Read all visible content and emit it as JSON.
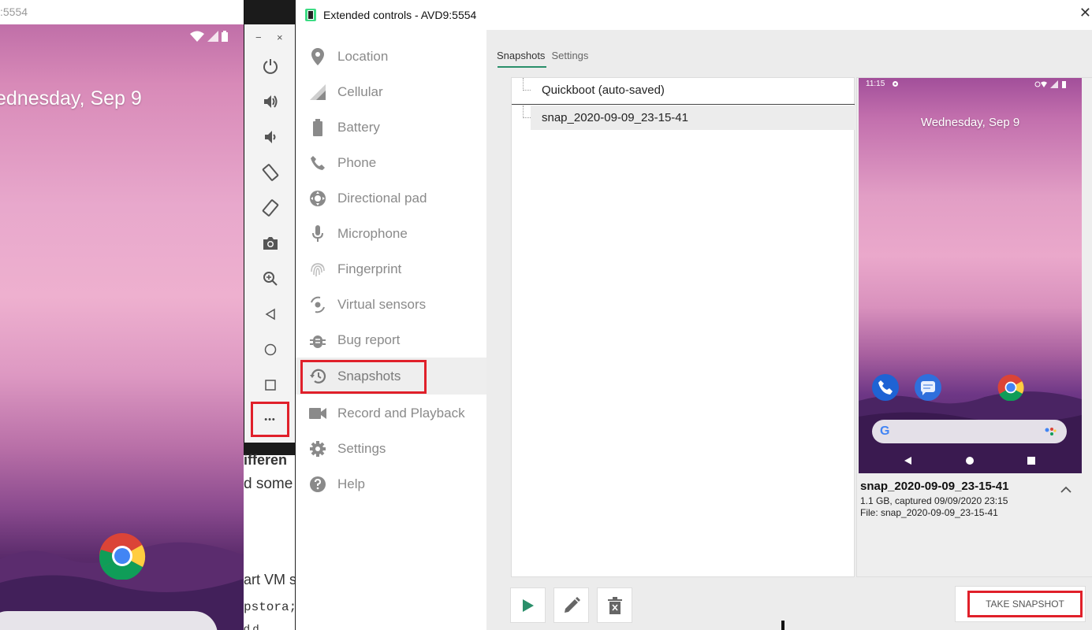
{
  "emulator": {
    "title": ":5554",
    "date": "ednesday, Sep 9",
    "toolbar": {
      "minimize": "−",
      "close": "×",
      "buttons": [
        "power-icon",
        "volume-up-icon",
        "volume-down-icon",
        "rotate-left-icon",
        "rotate-right-icon",
        "camera-icon",
        "zoom-icon",
        "back-icon",
        "home-icon",
        "overview-icon"
      ],
      "more_label": "•••"
    }
  },
  "background_doc": {
    "line1": "ifferen",
    "line2": "d some",
    "line3": "art VM s",
    "line4": "pstora;",
    "line5": "d d"
  },
  "extended_controls": {
    "title": "Extended controls - AVD9:5554",
    "close": "✕",
    "nav": [
      {
        "label": "Location",
        "icon": "location-pin-icon"
      },
      {
        "label": "Cellular",
        "icon": "cellular-signal-icon"
      },
      {
        "label": "Battery",
        "icon": "battery-icon"
      },
      {
        "label": "Phone",
        "icon": "phone-icon"
      },
      {
        "label": "Directional pad",
        "icon": "dpad-icon"
      },
      {
        "label": "Microphone",
        "icon": "microphone-icon"
      },
      {
        "label": "Fingerprint",
        "icon": "fingerprint-icon"
      },
      {
        "label": "Virtual sensors",
        "icon": "virtual-sensors-icon"
      },
      {
        "label": "Bug report",
        "icon": "bug-icon"
      },
      {
        "label": "Snapshots",
        "icon": "history-icon",
        "active": true
      },
      {
        "label": "Record and Playback",
        "icon": "video-camera-icon"
      },
      {
        "label": "Settings",
        "icon": "gear-icon"
      },
      {
        "label": "Help",
        "icon": "help-icon"
      }
    ],
    "tabs": {
      "snapshots": "Snapshots",
      "settings": "Settings"
    },
    "snapshots": [
      {
        "name": "Quickboot (auto-saved)"
      },
      {
        "name": "snap_2020-09-09_23-15-41",
        "selected": true
      }
    ],
    "preview": {
      "time": "11:15",
      "date": "Wednesday, Sep 9",
      "name": "snap_2020-09-09_23-15-41",
      "info": "1.1 GB, captured 09/09/2020 23:15",
      "file": "File: snap_2020-09-09_23-15-41"
    },
    "actions": {
      "play": "play-icon",
      "edit": "pencil-icon",
      "delete": "trash-icon",
      "take_snapshot": "TAKE SNAPSHOT"
    },
    "colors": {
      "accent": "#2a8f6a",
      "highlight": "#e0202a",
      "icon": "#8a8a8a"
    }
  }
}
